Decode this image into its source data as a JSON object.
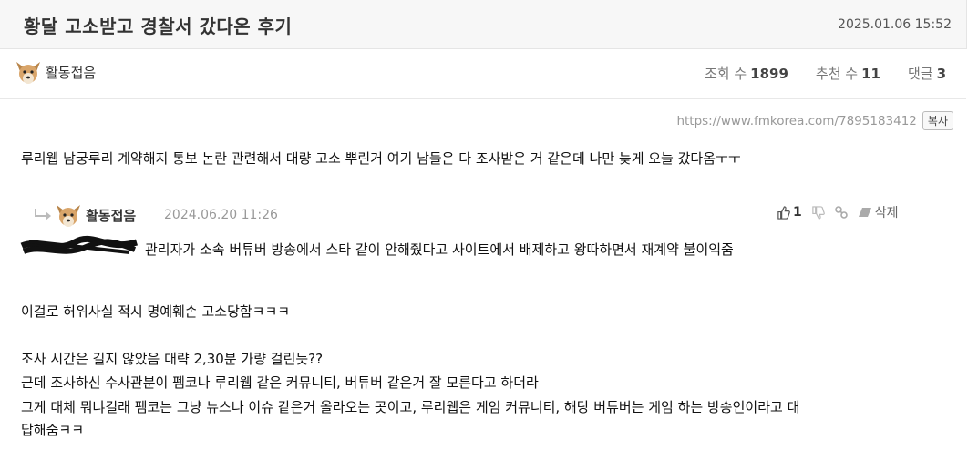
{
  "post": {
    "title": "황달 고소받고 경찰서 갔다온 후기",
    "date": "2025.01.06 15:52",
    "author": "활동접음",
    "views_label": "조회 수",
    "views": "1899",
    "likes_label": "추천 수",
    "likes": "11",
    "comments_label": "댓글",
    "comments": "3",
    "url": "https://www.fmkorea.com/7895183412",
    "copy_label": "복사"
  },
  "body": {
    "p1": "루리웹 남궁루리 계약해지 통보 논란 관련해서 대량 고소 뿌린거 여기 남들은 다 조사받은 거 같은데 나만 늦게 오늘 갔다옴ㅜㅜ",
    "p2": "이걸로 허위사실 적시 명예훼손 고소당함ㅋㅋㅋ",
    "p3": "조사 시간은 길지 않았음 대략 2,30분 가량 걸린듯??",
    "p4": "근데 조사하신 수사관분이 펨코나 루리웹 같은 커뮤니티, 버튜버 같은거 잘 모른다고 하더라",
    "p5a": "그게 대체 뭐냐길래 펨코는 그냥 뉴스나 이슈 같은거 올라오는 곳이고, 루리웹은 게임 커뮤니티, 해당 버튜버는 게임 하는 방송인이라고 대",
    "p5b": "답해줌ㅋㅋ"
  },
  "quote": {
    "author": "활동접음",
    "date": "2024.06.20 11:26",
    "like_count": "1",
    "delete_label": "삭제",
    "text": "관리자가 소속 버튜버 방송에서 스타 같이 안해줬다고 사이트에서 배제하고 왕따하면서 재계약 불이익줌"
  },
  "colors": {
    "header_bg": "#f7f7f7",
    "text": "#222222",
    "muted": "#999999"
  },
  "icons": [
    "dog-avatar-icon",
    "reply-arrow-icon",
    "thumb-up-icon",
    "thumb-down-icon",
    "link-icon",
    "eraser-icon"
  ]
}
